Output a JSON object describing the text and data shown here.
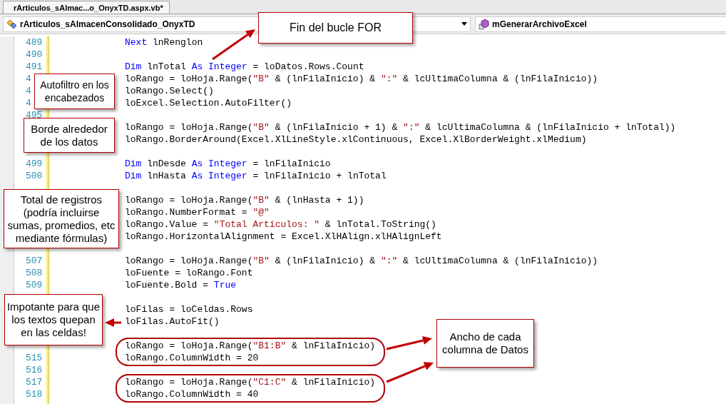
{
  "tab": {
    "label": "rArticulos_sAlmac...o_OnyxTD.aspx.vb*",
    "selected": true
  },
  "nav": {
    "class_combo": "rArticulos_sAlmacenConsolidado_OnyxTD",
    "member_combo": "mGenerarArchivoExcel"
  },
  "code_lines": [
    {
      "kind": "line",
      "number": "489",
      "segments": [
        {
          "kind": "keyword",
          "text": "Next"
        },
        {
          "kind": "plain",
          "text": " lnRenglon"
        }
      ]
    },
    {
      "kind": "line",
      "number": "490"
    },
    {
      "kind": "line",
      "number": "491",
      "segments": [
        {
          "kind": "keyword",
          "text": "Dim"
        },
        {
          "kind": "plain",
          "text": " lnTotal "
        },
        {
          "kind": "keyword",
          "text": "As"
        },
        {
          "kind": "keyword",
          "text": " Integer"
        },
        {
          "kind": "plain",
          "text": " = loDatos.Rows.Count"
        }
      ]
    },
    {
      "kind": "line",
      "number": "4",
      "segments": [
        {
          "kind": "plain",
          "text": "loRango = loHoja.Range("
        },
        {
          "kind": "string",
          "text": "\"B\""
        },
        {
          "kind": "plain",
          "text": " & (lnFilaInicio) & "
        },
        {
          "kind": "string",
          "text": "\":\""
        },
        {
          "kind": "plain",
          "text": " & lcUltimaColumna & (lnFilaInicio))"
        }
      ]
    },
    {
      "kind": "line",
      "number": "4",
      "segments": [
        {
          "kind": "plain",
          "text": "loRango.Select()"
        }
      ]
    },
    {
      "kind": "line",
      "number": "4",
      "segments": [
        {
          "kind": "plain",
          "text": "loExcel.Selection.AutoFilter()"
        }
      ]
    },
    {
      "kind": "line",
      "number": "495"
    },
    {
      "kind": "line",
      "segments": [
        {
          "kind": "plain",
          "text": "loRango = loHoja.Range("
        },
        {
          "kind": "string",
          "text": "\"B\""
        },
        {
          "kind": "plain",
          "text": " & (lnFilaInicio + 1) & "
        },
        {
          "kind": "string",
          "text": "\":\""
        },
        {
          "kind": "plain",
          "text": " & lcUltimaColumna & (lnFilaInicio + lnTotal))"
        }
      ]
    },
    {
      "kind": "line",
      "segments": [
        {
          "kind": "plain",
          "text": "loRango.BorderAround(Excel.XlLineStyle.xlContinuous, Excel.XlBorderWeight.xlMedium)"
        }
      ]
    },
    {
      "kind": "line"
    },
    {
      "kind": "line",
      "number": "499",
      "segments": [
        {
          "kind": "keyword",
          "text": "Dim"
        },
        {
          "kind": "plain",
          "text": " lnDesde "
        },
        {
          "kind": "keyword",
          "text": "As"
        },
        {
          "kind": "keyword",
          "text": " Integer"
        },
        {
          "kind": "plain",
          "text": " = lnFilaInicio"
        }
      ]
    },
    {
      "kind": "line",
      "number": "500",
      "segments": [
        {
          "kind": "keyword",
          "text": "Dim"
        },
        {
          "kind": "plain",
          "text": " lnHasta "
        },
        {
          "kind": "keyword",
          "text": "As"
        },
        {
          "kind": "keyword",
          "text": " Integer"
        },
        {
          "kind": "plain",
          "text": " = lnFilaInicio + lnTotal"
        }
      ]
    },
    {
      "kind": "line"
    },
    {
      "kind": "line",
      "segments": [
        {
          "kind": "plain",
          "text": "loRango = loHoja.Range("
        },
        {
          "kind": "string",
          "text": "\"B\""
        },
        {
          "kind": "plain",
          "text": " & (lnHasta + 1))"
        }
      ]
    },
    {
      "kind": "line",
      "segments": [
        {
          "kind": "plain",
          "text": "loRango.NumberFormat = "
        },
        {
          "kind": "string",
          "text": "\"@\""
        }
      ]
    },
    {
      "kind": "line",
      "segments": [
        {
          "kind": "plain",
          "text": "loRango.Value = "
        },
        {
          "kind": "string",
          "text": "\"Total Artículos: \""
        },
        {
          "kind": "plain",
          "text": " & lnTotal.ToString()"
        }
      ]
    },
    {
      "kind": "line",
      "segments": [
        {
          "kind": "plain",
          "text": "loRango.HorizontalAlignment = Excel.XlHAlign.xlHAlignLeft"
        }
      ]
    },
    {
      "kind": "line"
    },
    {
      "kind": "line",
      "number": "507",
      "segments": [
        {
          "kind": "plain",
          "text": "loRango = loHoja.Range("
        },
        {
          "kind": "string",
          "text": "\"B\""
        },
        {
          "kind": "plain",
          "text": " & (lnFilaInicio) & "
        },
        {
          "kind": "string",
          "text": "\":\""
        },
        {
          "kind": "plain",
          "text": " & lcUltimaColumna & (lnFilaInicio))"
        }
      ]
    },
    {
      "kind": "line",
      "number": "508",
      "segments": [
        {
          "kind": "plain",
          "text": "loFuente = loRango.Font"
        }
      ]
    },
    {
      "kind": "line",
      "number": "509",
      "segments": [
        {
          "kind": "plain",
          "text": "loFuente.Bold = "
        },
        {
          "kind": "keyword",
          "text": "True"
        }
      ]
    },
    {
      "kind": "line"
    },
    {
      "kind": "line",
      "segments": [
        {
          "kind": "plain",
          "text": "loFilas = loCeldas.Rows"
        }
      ]
    },
    {
      "kind": "line",
      "segments": [
        {
          "kind": "plain",
          "text": "loFilas.AutoFit()"
        }
      ]
    },
    {
      "kind": "line"
    },
    {
      "kind": "outlined_group",
      "children": [
        {
          "kind": "line",
          "segments": [
            {
              "kind": "plain",
              "text": "loRango = loHoja.Range("
            },
            {
              "kind": "string",
              "text": "\"B1:B\""
            },
            {
              "kind": "plain",
              "text": " & lnFilaInicio)"
            }
          ]
        },
        {
          "kind": "line",
          "number": "515",
          "segments": [
            {
              "kind": "plain",
              "text": "loRango.ColumnWidth = 20"
            }
          ]
        }
      ]
    },
    {
      "kind": "line",
      "number": "516"
    },
    {
      "kind": "outlined_group",
      "children": [
        {
          "kind": "line",
          "number": "517",
          "segments": [
            {
              "kind": "plain",
              "text": "loRango = loHoja.Range("
            },
            {
              "kind": "string",
              "text": "\"C1:C\""
            },
            {
              "kind": "plain",
              "text": " & lnFilaInicio)"
            }
          ]
        },
        {
          "kind": "line",
          "number": "518",
          "segments": [
            {
              "kind": "plain",
              "text": "loRango.ColumnWidth = 40"
            }
          ]
        }
      ]
    }
  ],
  "callouts": [
    {
      "text": "Fin del bucle FOR"
    },
    {
      "text": "Autofiltro en los\nencabezados"
    },
    {
      "text": "Borde alrededor\nde los datos"
    },
    {
      "text": "Total de registros\n(podría incluirse\nsumas, promedios, etc\nmediante fórmulas)"
    },
    {
      "text": "Impotante para que\nlos textos quepan\nen las celdas!"
    },
    {
      "text": "Ancho de cada\ncolumna de Datos"
    }
  ]
}
